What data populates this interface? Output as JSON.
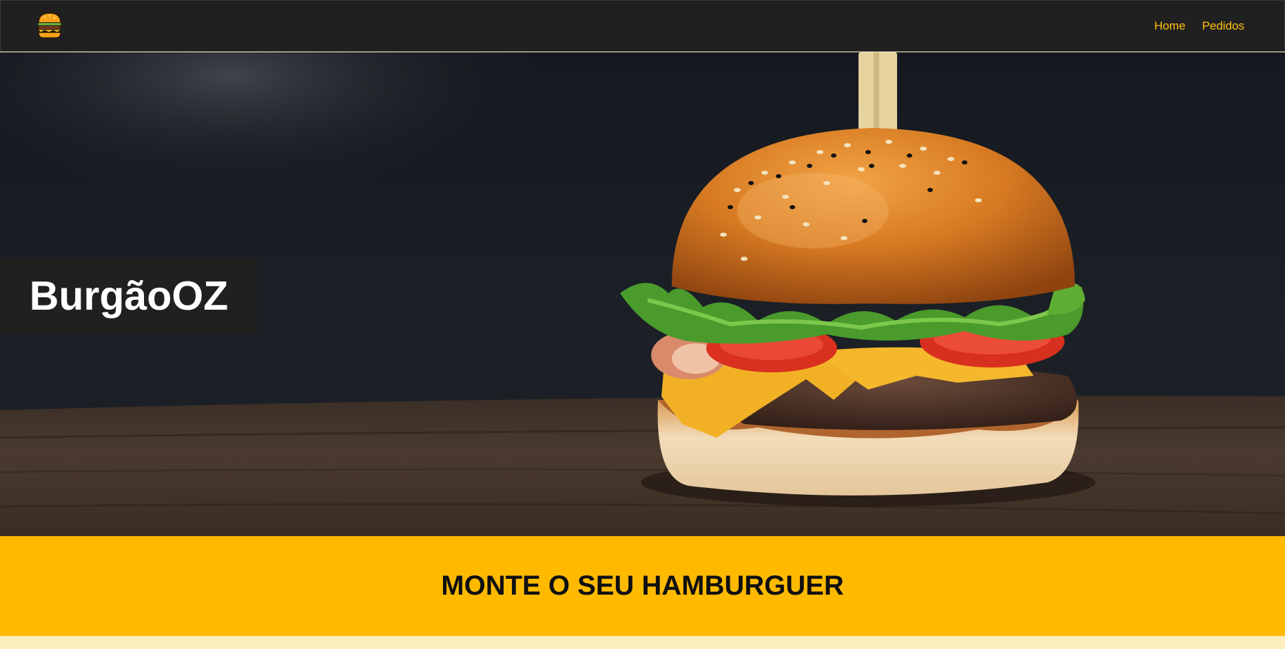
{
  "navbar": {
    "logo_icon": "burger-icon",
    "links": [
      {
        "label": "Home"
      },
      {
        "label": "Pedidos"
      }
    ],
    "link_color": "#ffc107",
    "background": "#202020"
  },
  "hero": {
    "title": "BurgãoOZ",
    "image": "burger-photo"
  },
  "banner": {
    "title": "MONTE O SEU HAMBURGUER",
    "background": "#ffba00"
  },
  "colors": {
    "accent": "#ffba00",
    "dark": "#202020",
    "cream": "#fdeebd"
  }
}
